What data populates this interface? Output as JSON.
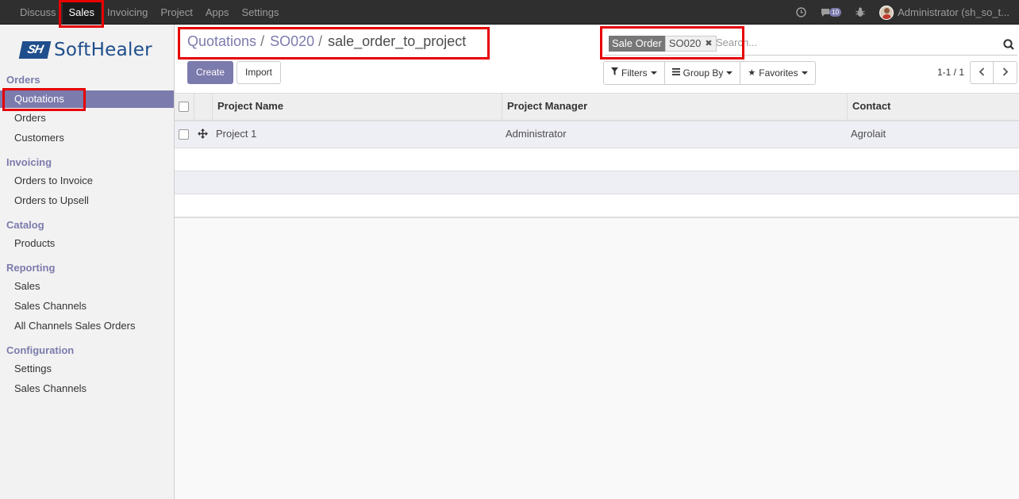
{
  "topbar": {
    "menu": [
      "Discuss",
      "Sales",
      "Invoicing",
      "Project",
      "Apps",
      "Settings"
    ],
    "active": "Sales",
    "chat_count": "10",
    "user_name": "Administrator (sh_so_t..."
  },
  "logo": {
    "mark": "SH",
    "text": "SoftHealer"
  },
  "sidebar": {
    "orders_title": "Orders",
    "quotations": "Quotations",
    "orders": "Orders",
    "customers": "Customers",
    "invoicing_title": "Invoicing",
    "orders_to_invoice": "Orders to Invoice",
    "orders_to_upsell": "Orders to Upsell",
    "catalog_title": "Catalog",
    "products": "Products",
    "reporting_title": "Reporting",
    "rep_sales": "Sales",
    "rep_sales_channels": "Sales Channels",
    "rep_all_channels": "All Channels Sales Orders",
    "configuration_title": "Configuration",
    "conf_settings": "Settings",
    "conf_sales_channels": "Sales Channels"
  },
  "breadcrumb": {
    "first": "Quotations",
    "second": "SO020",
    "current": "sale_order_to_project",
    "sep": "/"
  },
  "search": {
    "facet_label": "Sale Order",
    "facet_value": "SO020",
    "placeholder": "Search..."
  },
  "buttons": {
    "create": "Create",
    "import": "Import"
  },
  "filters": {
    "filters": "Filters",
    "group_by": "Group By",
    "favorites": "Favorites"
  },
  "pager": {
    "value": "1-1 / 1"
  },
  "table": {
    "columns": [
      "Project Name",
      "Project Manager",
      "Contact"
    ],
    "rows": [
      {
        "project_name": "Project 1",
        "project_manager": "Administrator",
        "contact": "Agrolait"
      }
    ]
  },
  "colors": {
    "brand": "#7c7bad",
    "highlight": "#e60000",
    "navbar": "#2f2f2f"
  }
}
